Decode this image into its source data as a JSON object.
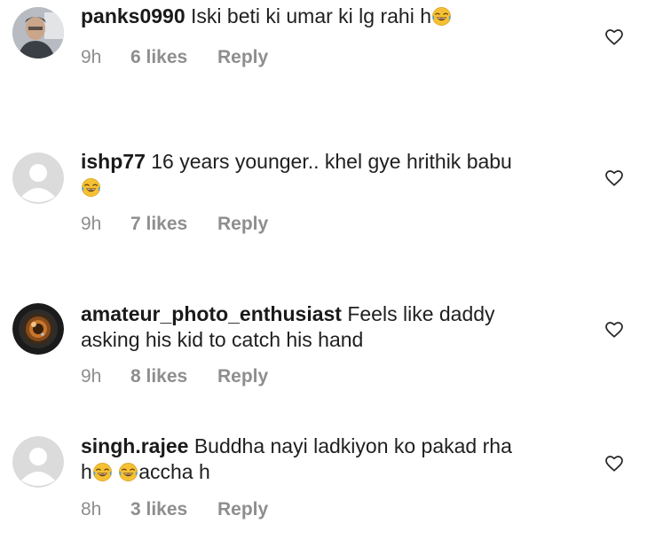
{
  "comments": [
    {
      "username": "panks0990",
      "text_before_emoji": "Iski beti ki umar ki lg rahi h",
      "time": "9h",
      "likes": "6 likes",
      "reply": "Reply",
      "avatar": "user-photo-avatar"
    },
    {
      "username": "ishp77",
      "text_line1": "16 years younger.. khel gye hrithik babu",
      "time": "9h",
      "likes": "7 likes",
      "reply": "Reply",
      "avatar": "default-avatar"
    },
    {
      "username": "amateur_photo_enthusiast",
      "text_line1": "Feels like daddy",
      "text_line2": "asking his kid to catch his hand",
      "time": "9h",
      "likes": "8 likes",
      "reply": "Reply",
      "avatar": "camera-lens-avatar"
    },
    {
      "username": "singh.rajee",
      "text_line1": "Buddha nayi ladkiyon ko pakad rha",
      "text_line2a": "h",
      "text_line2b": "accha h",
      "time": "8h",
      "likes": "3 likes",
      "reply": "Reply",
      "avatar": "default-avatar"
    }
  ],
  "icons": {
    "like": "heart-outline-icon",
    "emoji": "face-with-tears-of-joy"
  },
  "colors": {
    "text": "#262626",
    "meta": "#8e8e8e",
    "emoji_face": "#f5c133",
    "tears": "#4aa3e0"
  }
}
